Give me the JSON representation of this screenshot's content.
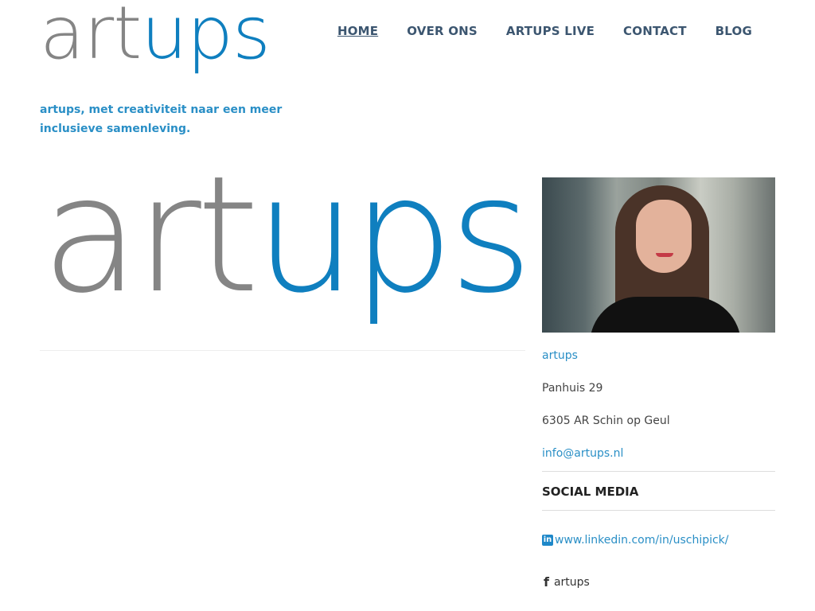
{
  "header": {
    "logo": {
      "part1": "art",
      "part2": "ups"
    },
    "tagline": "artups, met creativiteit naar een meer inclusieve samenleving."
  },
  "nav": {
    "items": [
      {
        "label": "HOME",
        "active": true
      },
      {
        "label": "OVER ONS",
        "active": false
      },
      {
        "label": "ARTUPS LIVE",
        "active": false
      },
      {
        "label": "CONTACT",
        "active": false
      },
      {
        "label": "BLOG",
        "active": false
      }
    ]
  },
  "hero": {
    "logo": {
      "part1": "art",
      "part2": "ups"
    }
  },
  "sidebar": {
    "contact": {
      "name": "artups",
      "street": "Panhuis 29",
      "city": "6305 AR Schin op Geul",
      "email": "info@artups.nl"
    },
    "social": {
      "title": "SOCIAL MEDIA",
      "linkedin_icon": "in",
      "linkedin": "www.linkedin.com/in/uschipick/",
      "facebook_icon": "f",
      "facebook": "artups"
    }
  },
  "colors": {
    "brand_grey": "#858585",
    "brand_blue": "#0f7fbf",
    "link": "#2a8fc6",
    "nav": "#3c5670"
  },
  "icons": {
    "linkedin": "linkedin-icon",
    "facebook": "facebook-icon"
  }
}
